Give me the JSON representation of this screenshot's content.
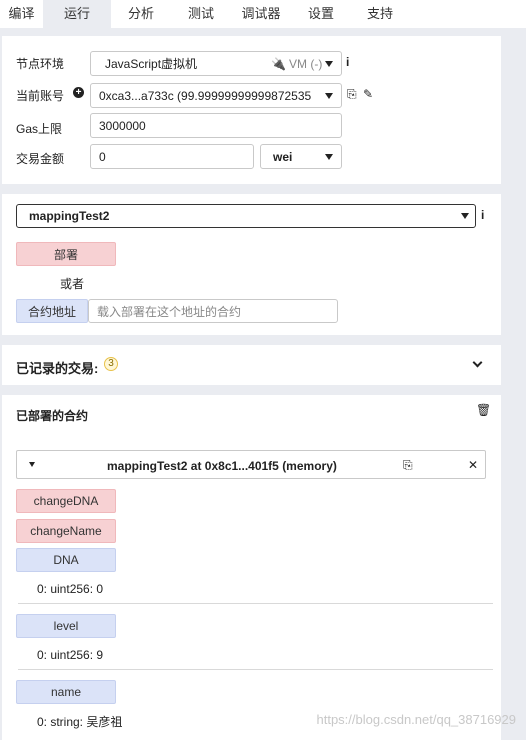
{
  "tabs": [
    "编译",
    "运行",
    "分析",
    "测试",
    "调试器",
    "设置",
    "支持"
  ],
  "active_tab": "运行",
  "env": {
    "env_label": "节点环境",
    "env_value": "JavaScript虚拟机",
    "env_suffix": "VM (-)",
    "account_label": "当前账号",
    "account_value": "0xca3...a733c (99.9999999999987253​5",
    "gas_label": "Gas上限",
    "gas_value": "3000000",
    "amount_label": "交易金额",
    "amount_value": "0",
    "unit_value": "wei"
  },
  "deploy": {
    "contract_select": "mappingTest2",
    "deploy_button": "部署",
    "or_text": "或者",
    "at_address_button": "合约地址",
    "at_address_placeholder": "载入部署在这个地址的合约"
  },
  "transactions": {
    "title": "已记录的交易:",
    "count": "3"
  },
  "deployed": {
    "title": "已部署的合约",
    "instance_title": "mappingTest2 at 0x8c1...401f5 (memory)",
    "buttons": {
      "change_dna": "changeDNA",
      "change_name": "changeName",
      "dna": "DNA",
      "level": "level",
      "name": "name"
    },
    "results": {
      "dna": "0: uint256: 0",
      "level": "0: uint256: 9",
      "name": "0: string: 吴彦祖"
    }
  },
  "watermark": "https://blog.csdn.net/qq_38716929",
  "colors": {
    "page_bg": "#eaecf1",
    "red_button": "#f7d1d3",
    "blue_button": "#dbe3f8"
  },
  "icons": [
    "info-icon",
    "plus-circle-icon",
    "copy-icon",
    "edit-icon",
    "plug-icon",
    "chevron-down-icon",
    "trash-icon",
    "caret-down-icon",
    "close-icon"
  ]
}
